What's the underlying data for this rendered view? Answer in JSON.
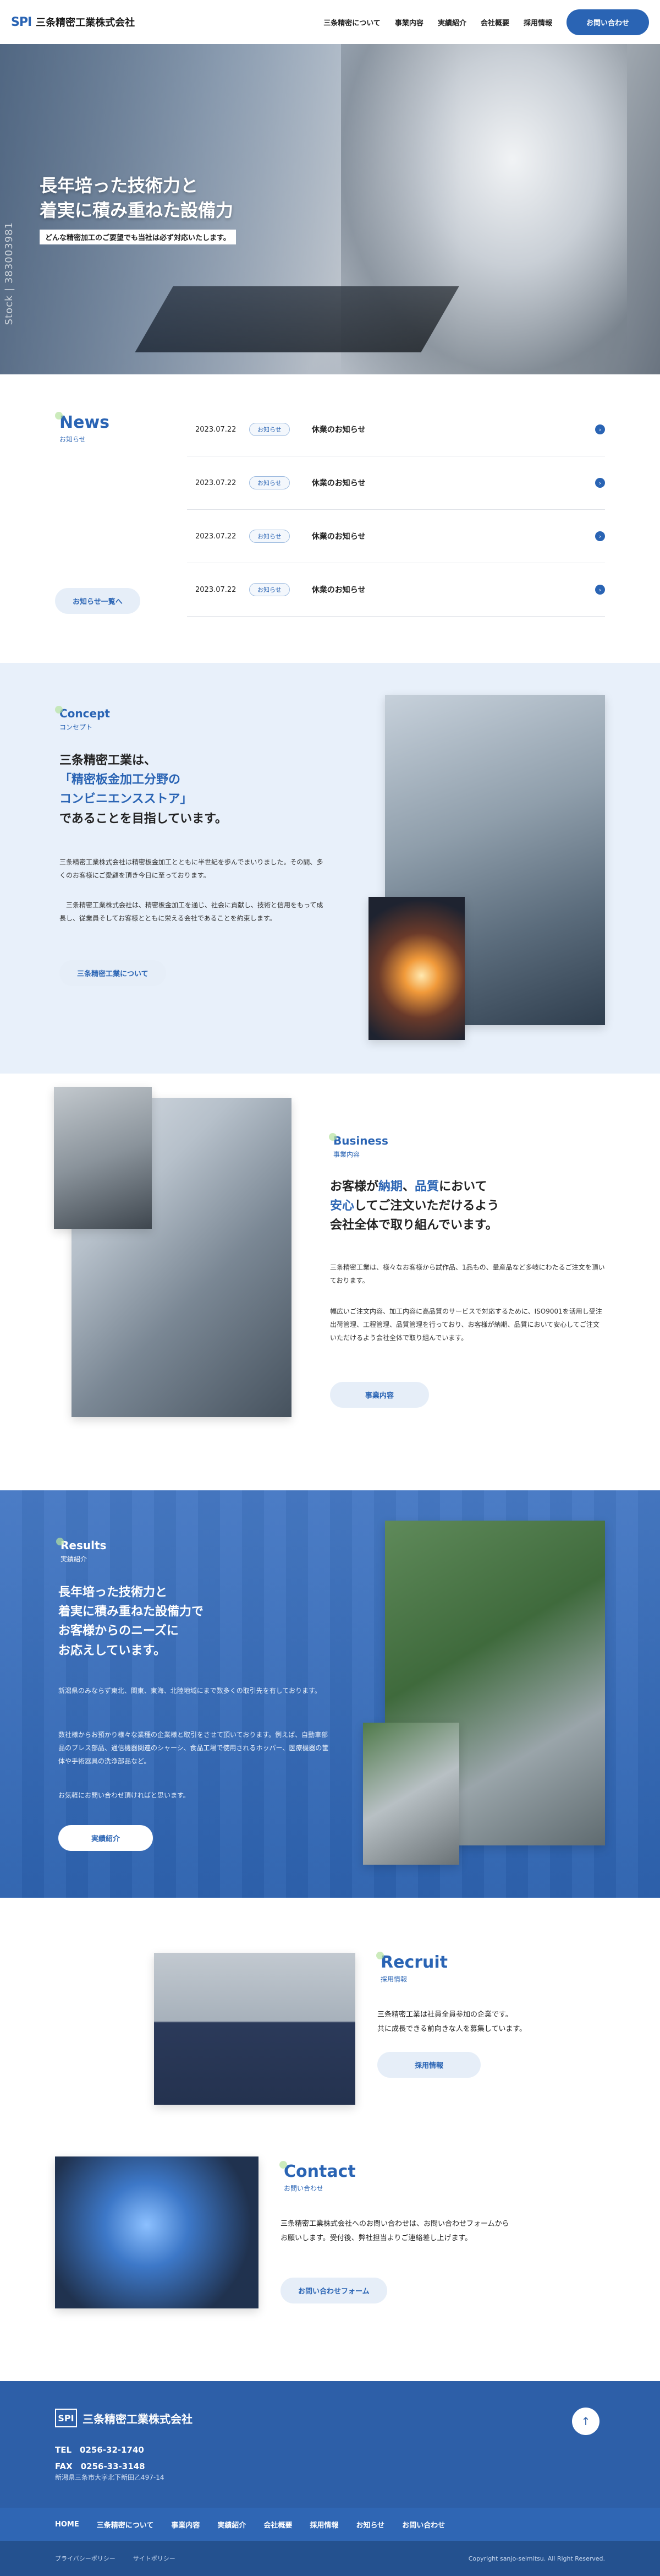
{
  "header": {
    "logo_mark": "SPI",
    "logo_text": "三条精密工業株式会社",
    "nav": [
      "三条精密について",
      "事業内容",
      "実績紹介",
      "会社概要",
      "採用情報"
    ],
    "contact_button": "お問い合わせ"
  },
  "hero": {
    "title_line1": "長年培った技術力と",
    "title_line2": "着実に積み重ねた設備力",
    "tagline": "どんな精密加工のご要望でも当社は必ず対応いたします。",
    "side_credit": "Stock | 383003981"
  },
  "news": {
    "title_en": "News",
    "title_ja": "お知らせ",
    "more_button": "お知らせ一覧へ",
    "items": [
      {
        "date": "2023.07.22",
        "badge": "お知らせ",
        "text": "休業のお知らせ"
      },
      {
        "date": "2023.07.22",
        "badge": "お知らせ",
        "text": "休業のお知らせ"
      },
      {
        "date": "2023.07.22",
        "badge": "お知らせ",
        "text": "休業のお知らせ"
      },
      {
        "date": "2023.07.22",
        "badge": "お知らせ",
        "text": "休業のお知らせ"
      }
    ]
  },
  "concept": {
    "title_en": "Concept",
    "title_ja": "コンセプト",
    "head1": "三条精密工業は、",
    "head2": "「精密板金加工分野の",
    "head3": "コンビニエンスストア」",
    "head4": "であることを目指しています。",
    "p1": "三条精密工業株式会社は精密板金加工とともに半世紀を歩んでまいりました。その間、多くのお客様にご愛顧を頂き今日に至っております。",
    "p2": "三条精密工業株式会社は、精密板金加工を通じ、社会に貢献し、技術と信用をもって成長し、従業員そしてお客様とともに栄える会社であることを約束します。",
    "button": "三条精密工業について"
  },
  "business": {
    "title_en": "Business",
    "title_ja": "事業内容",
    "head1a": "お客様が",
    "head1b": "納期",
    "head1c": "、",
    "head1d": "品質",
    "head1e": "において",
    "head2a": "安心",
    "head2b": "してご注文いただけるよう",
    "head3": "会社全体で取り組んでいます。",
    "p1": "三条精密工業は、様々なお客様から試作品、1品もの、量産品など多岐にわたるご注文を頂いております。",
    "p2": "幅広いご注文内容、加工内容に高品質のサービスで対応するために、ISO9001を活用し受注出荷管理、工程管理、品質管理を行っており、お客様が納期、品質において安心してご注文いただけるよう会社全体で取り組んでいます。",
    "button": "事業内容"
  },
  "results": {
    "title_en": "Results",
    "title_ja": "実績紹介",
    "head1": "長年培った技術力と",
    "head2": "着実に積み重ねた設備力で",
    "head3": "お客様からのニーズに",
    "head4": "お応えしています。",
    "p1": "新潟県のみならず東北、関東、東海、北陸地域にまで数多くの取引先を有しております。",
    "p2": "数社様からお預かり様々な業種の企業様と取引をさせて頂いております。例えば、自動車部品のプレス部品、通信機器関連のシャーシ、食品工場で使用されるホッパー、医療機器の筐体や手術器具の洗浄部品など。",
    "p3": "お気軽にお問い合わせ頂ければと思います。",
    "button": "実績紹介"
  },
  "recruit": {
    "title_en": "Recruit",
    "title_ja": "採用情報",
    "p1": "三条精密工業は社員全員参加の企業です。",
    "p2": "共に成長できる前向きな人を募集しています。",
    "button": "採用情報"
  },
  "contact": {
    "title_en": "Contact",
    "title_ja": "お問い合わせ",
    "p": "三条精密工業株式会社へのお問い合わせは、お問い合わせフォームからお願いします。受付後、弊社担当よりご連絡差し上げます。",
    "button": "お問い合わせフォーム"
  },
  "footer": {
    "logo_mark": "SPI",
    "name": "三条精密工業株式会社",
    "tel": "TEL　0256-32-1740",
    "fax": "FAX　0256-33-3148",
    "address": "新潟県三条市大字北下新田乙497-14",
    "to_top": "↑",
    "nav": [
      "HOME",
      "三条精密について",
      "事業内容",
      "実績紹介",
      "会社概要",
      "採用情報",
      "お知らせ",
      "お問い合わせ"
    ],
    "links": [
      "プライバシーポリシー",
      "サイトポリシー"
    ],
    "copyright": "Copyright sanjo-seimitsu. All Right Reserved."
  }
}
